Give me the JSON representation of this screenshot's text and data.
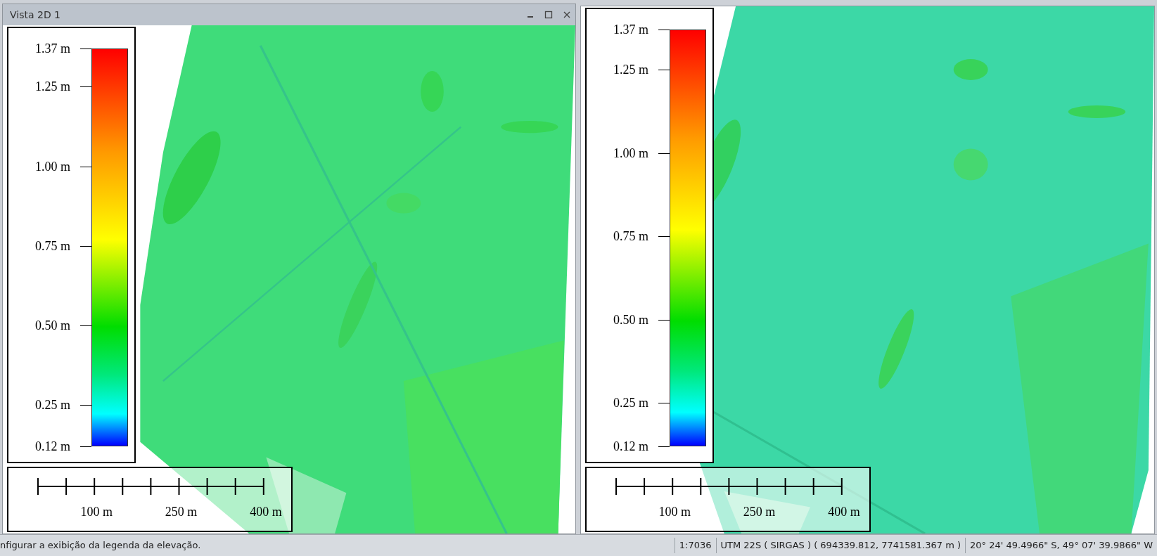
{
  "window": {
    "title": "Vista 2D 1"
  },
  "views": [
    {
      "legend": {
        "ticks": [
          {
            "label": "1.37 m",
            "level": 1
          },
          {
            "label": "1.25 m",
            "level": 0.904
          },
          {
            "label": "1.00 m",
            "level": 0.704
          },
          {
            "label": "0.75 m",
            "level": 0.504
          },
          {
            "label": "0.50 m",
            "level": 0.304
          },
          {
            "label": "0.25 m",
            "level": 0.104
          },
          {
            "label": "0.12 m",
            "level": 0
          }
        ]
      },
      "scale_bar": {
        "labels": [
          "100 m",
          "250 m",
          "400 m"
        ]
      }
    },
    {
      "legend": {
        "ticks": [
          {
            "label": "1.37 m",
            "level": 1
          },
          {
            "label": "1.25 m",
            "level": 0.904
          },
          {
            "label": "1.00 m",
            "level": 0.704
          },
          {
            "label": "0.75 m",
            "level": 0.504
          },
          {
            "label": "0.50 m",
            "level": 0.304
          },
          {
            "label": "0.25 m",
            "level": 0.104
          },
          {
            "label": "0.12 m",
            "level": 0
          }
        ]
      },
      "scale_bar": {
        "labels": [
          "100 m",
          "250 m",
          "400 m"
        ]
      }
    }
  ],
  "status_bar": {
    "message": "nfigurar a exibição da legenda da elevação.",
    "scale": "1:7036",
    "projection": "UTM 22S ( SIRGAS ) ( 694339.812, 7741581.367 m )",
    "coordinates": "20° 24' 49.4966\" S, 49° 07' 39.9866\" W"
  }
}
